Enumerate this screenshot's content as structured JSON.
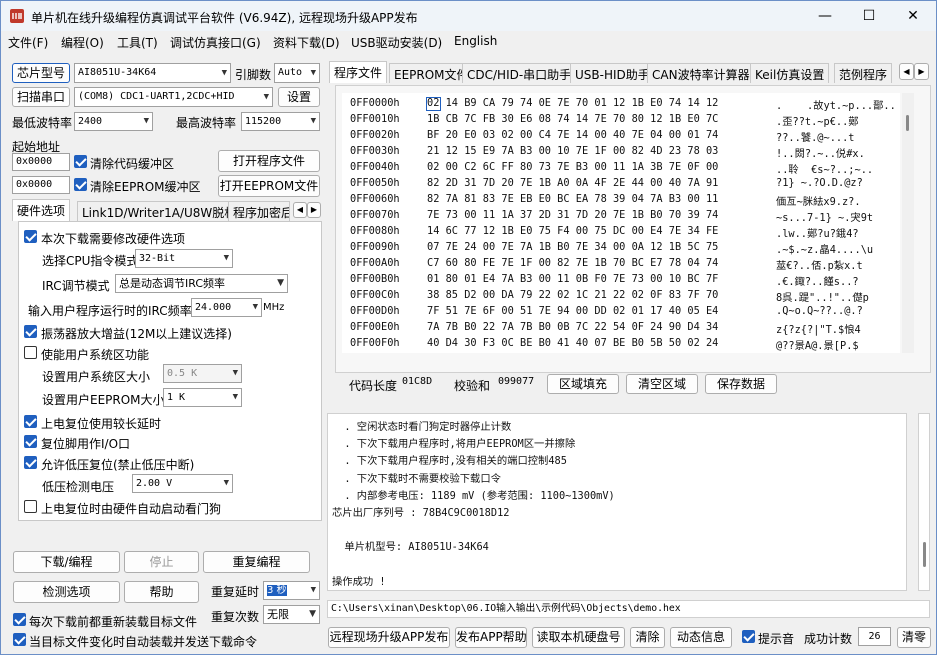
{
  "title": "单片机在线升级编程仿真调试平台软件 (V6.94Z), 远程现场升级APP发布",
  "window_controls": {
    "minimize": "—",
    "maximize": "☐",
    "close": "✕"
  },
  "menu": [
    "文件(F)",
    "编程(O)",
    "工具(T)",
    "调试仿真接口(G)",
    "资料下载(D)",
    "USB驱动安装(D)",
    "English"
  ],
  "left": {
    "chip_type_btn": "芯片型号",
    "chip_value": "AI8051U-34K64",
    "pin_count_label": "引脚数",
    "pin_count_value": "Auto",
    "scan_port_btn": "扫描串口",
    "port_value": "(COM8) CDC1-UART1,2CDC+HID",
    "settings_btn": "设置",
    "min_baud_label": "最低波特率",
    "min_baud_value": "2400",
    "max_baud_label": "最高波特率",
    "max_baud_value": "115200",
    "start_addr_label": "起始地址",
    "addr1": "0x0000",
    "clear_code_label": "清除代码缓冲区",
    "open_prog_btn": "打开程序文件",
    "addr2": "0x0000",
    "clear_eeprom_label": "清除EEPROM缓冲区",
    "open_eeprom_btn": "打开EEPROM文件",
    "tabs": [
      "硬件选项",
      "Link1D/Writer1A/U8W脱机",
      "程序加密后"
    ],
    "hw": {
      "modify_hw": "本次下载需要修改硬件选项",
      "cpu_label": "选择CPU指令模式",
      "cpu_value": "32-Bit",
      "irc_mode_label": "IRC调节模式",
      "irc_mode_value": "总是动态调节IRC频率",
      "irc_freq_label": "输入用户程序运行时的IRC频率",
      "irc_freq_value": "24.000",
      "irc_unit": "MHz",
      "osc_gain": "振荡器放大增益(12M以上建议选择)",
      "enable_sys": "使能用户系统区功能",
      "sys_size_label": "设置用户系统区大小",
      "sys_size_value": "0.5 K",
      "eeprom_size_label": "设置用户EEPROM大小",
      "eeprom_size_value": "1   K",
      "power_delay": "上电复位使用较长延时",
      "reset_io": "复位脚用作I/O口",
      "lvr": "允许低压复位(禁止低压中断)",
      "lvd_label": "低压检测电压",
      "lvd_value": "2.00 V",
      "wdt": "上电复位时由硬件自动启动看门狗"
    },
    "download_btn": "下载/编程",
    "stop_btn": "停止",
    "reprogram_btn": "重复编程",
    "check_btn": "检测选项",
    "help_btn": "帮助",
    "repeat_delay_label": "重复延时",
    "repeat_delay_value": "3 秒",
    "repeat_count_label": "重复次数",
    "repeat_count_value": "无限",
    "reload_before": "每次下载前都重新装载目标文件",
    "auto_reload": "当目标文件变化时自动装载并发送下载命令"
  },
  "right": {
    "tabs": [
      "程序文件",
      "EEPROM文件",
      "CDC/HID-串口助手",
      "USB-HID助手",
      "CAN波特率计算器",
      "Keil仿真设置",
      "范例程序"
    ],
    "hex_rows": [
      {
        "addr": "0FF0000h",
        "bytes": "02 14 B9 CA 79 74 0E 7E 70 01 12 1B E0 74 14 12",
        "ascii": ".    .故yt.~p...鄑.."
      },
      {
        "addr": "0FF0010h",
        "bytes": "1B CB 7C FB 30 E6 08 74 14 7E 70 80 12 1B E0 7C",
        "ascii": ".歪??t.~p€..鄚"
      },
      {
        "addr": "0FF0020h",
        "bytes": "BF 20 E0 03 02 00 C4 7E 14 00 40 7E 04 00 01 74",
        "ascii": "??..饕.@~...t"
      },
      {
        "addr": "0FF0030h",
        "bytes": "21 12 15 E9 7A B3 00 10 7E 1F 00 82 4D 23 78 03",
        "ascii": "!..閦?.~..侻#x."
      },
      {
        "addr": "0FF0040h",
        "bytes": "02 00 C2 6C FF 80 73 7E B3 00 11 1A 3B 7E 0F 00",
        "ascii": "..聆  €s~?..;~.."
      },
      {
        "addr": "0FF0050h",
        "bytes": "82 2D 31 7D 20 7E 1B A0 0A 4F 2E 44 00 40 7A 91",
        "ascii": "?1} ~.?O.D.@z?"
      },
      {
        "addr": "0FF0060h",
        "bytes": "82 7A 81 83 7E EB E0 BC EA 78 39 04 7A B3 00 11",
        "ascii": "偭亙~脒紶x9.z?."
      },
      {
        "addr": "0FF0070h",
        "bytes": "7E 73 00 11 1A 37 2D 31 7D 20 7E 1B B0 70 39 74",
        "ascii": "~s...7-1} ~.宊9t"
      },
      {
        "addr": "0FF0080h",
        "bytes": "14 6C 77 12 1B E0 75 F4 00 75 DC 00 E4 7E 34 FE",
        "ascii": ".lw..鄚?u?鋨4?"
      },
      {
        "addr": "0FF0090h",
        "bytes": "07 7E 24 00 7E 7A 1B B0 7E 34 00 0A 12 1B 5C 75",
        "ascii": ".~$.~z.皛4....\\u"
      },
      {
        "addr": "0FF00A0h",
        "bytes": "C7 60 80 FE 7E 1F 00 82 7E 1B 70 BC E7 78 04 74",
        "ascii": "莁€?..俖.p紮x.t"
      },
      {
        "addr": "0FF00B0h",
        "bytes": "01 80 01 E4 7A B3 00 11 0B F0 7E 73 00 10 BC 7F",
        "ascii": ".€.鋷?..饉s..?"
      },
      {
        "addr": "0FF00C0h",
        "bytes": "38 85 D2 00 DA 79 22 02 1C 21 22 02 0F 83 7F 70",
        "ascii": "8呉.踶\"..!\"..儊p"
      },
      {
        "addr": "0FF00D0h",
        "bytes": "7F 51 7E 6F 00 51 7E 94 00 DD 02 01 17 40 05 E4",
        "ascii": ".Q~o.Q~??..@.?"
      },
      {
        "addr": "0FF00E0h",
        "bytes": "7A 7B B0 22 7A 7B B0 0B 7C 22 54 0F 24 90 D4 34",
        "ascii": "z{?z{?|\"T.$悢4"
      },
      {
        "addr": "0FF00F0h",
        "bytes": "40 D4 30 F3 0C BE B0 41 40 07 BE B0 5B 50 02 24",
        "ascii": "@??景A@.景[P.$"
      }
    ],
    "code_len_label": "代码长度",
    "code_len_value": "01C8D",
    "checksum_label": "校验和",
    "checksum_value": "099077",
    "fill_btn": "区域填充",
    "clear_btn": "清空区域",
    "save_btn": "保存数据",
    "log": [
      "  . 空闲状态时看门狗定时器停止计数",
      "  . 下次下载用户程序时,将用户EEPROM区一并擦除",
      "  . 下次下载用户程序时,没有相关的端口控制485",
      "  . 下次下载时不需要校验下载口令",
      "  . 内部参考电压: 1189 mV (参考范围: 1100~1300mV)",
      "芯片出厂序列号 : 78B4C9C0018D12",
      "",
      "  单片机型号: AI8051U-34K64",
      "",
      "操作成功 !"
    ],
    "file_path": "C:\\Users\\xinan\\Desktop\\06.IO输入输出\\示例代码\\Objects\\demo.hex",
    "publish_btn": "远程现场升级APP发布",
    "publish_help_btn": "发布APP帮助",
    "read_disk_btn": "读取本机硬盘号",
    "clear_log_btn": "清除",
    "dynamic_btn": "动态信息",
    "beep_label": "提示音",
    "success_label": "成功计数",
    "success_value": "26",
    "clear_zero_btn": "清零"
  }
}
